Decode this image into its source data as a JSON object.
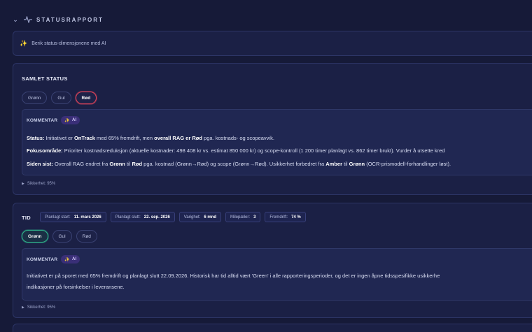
{
  "header": {
    "title": "STATUSRAPPORT"
  },
  "ai_enrich": {
    "label": "Berik status-dimensjonene med AI"
  },
  "samlet": {
    "title": "SAMLET STATUS",
    "pills": [
      "Grønn",
      "Gul",
      "Rød"
    ],
    "selected": "Rød",
    "comment": {
      "label": "KOMMENTAR",
      "badge": "AI",
      "status_label": "Status:",
      "status_text": " Initiativet er ",
      "status_bold1": "OnTrack",
      "status_text2": " med 65% fremdrift, men ",
      "status_bold2": "overall RAG er Rød",
      "status_text3": " pga. kostnads- og scopeavvik.",
      "focus_label": "Fokusområde:",
      "focus_text": " Prioriter kostnadsreduksjon (aktuelle kostnader: 498 408 kr vs. estimat 850 000 kr) og scope-kontroll (1 200 timer planlagt vs. 862 timer brukt). Vurder å utsette kred",
      "since_label": "Siden sist:",
      "since_text1": " Overall RAG endret fra ",
      "since_bold1": "Grønn",
      "since_text2": " til ",
      "since_bold2": "Rød",
      "since_text3": " pga. kostnad (Grønn→Rød) og scope (Grønn→Rød). Usikkerhet forbedret fra ",
      "since_bold3": "Amber",
      "since_text4": " til ",
      "since_bold4": "Grønn",
      "since_text5": " (OCR-prismodell-forhandlinger løst)."
    },
    "certainty": "Sikkerhet: 95%"
  },
  "tid": {
    "title": "TID",
    "meta": [
      {
        "label": "Planlagt start:",
        "value": "11. mars 2026"
      },
      {
        "label": "Planlagt slutt:",
        "value": "22. sep. 2026"
      },
      {
        "label": "Varighet:",
        "value": "6 mnd"
      },
      {
        "label": "Milepæler:",
        "value": "3"
      },
      {
        "label": "Fremdrift:",
        "value": "74 %"
      }
    ],
    "pills": [
      "Grønn",
      "Gul",
      "Rød"
    ],
    "selected": "Grønn",
    "comment": {
      "label": "KOMMENTAR",
      "badge": "AI",
      "line1": "Initiativet er på sporet med 65% fremdrift og planlagt slutt 22.09.2026. Historisk har tid alltid vært 'Green' i alle rapporteringsperioder, og det er ingen åpne tidsspesifikke usikkerhe",
      "line2": "indikasjoner på forsinkelser i leveransene."
    },
    "certainty": "Sikkerhet: 95%"
  },
  "colors": {
    "background": "#161a38",
    "card": "#1b2045",
    "red": "#e0445a",
    "green": "#2fb38a",
    "ai": "#a994ff"
  }
}
